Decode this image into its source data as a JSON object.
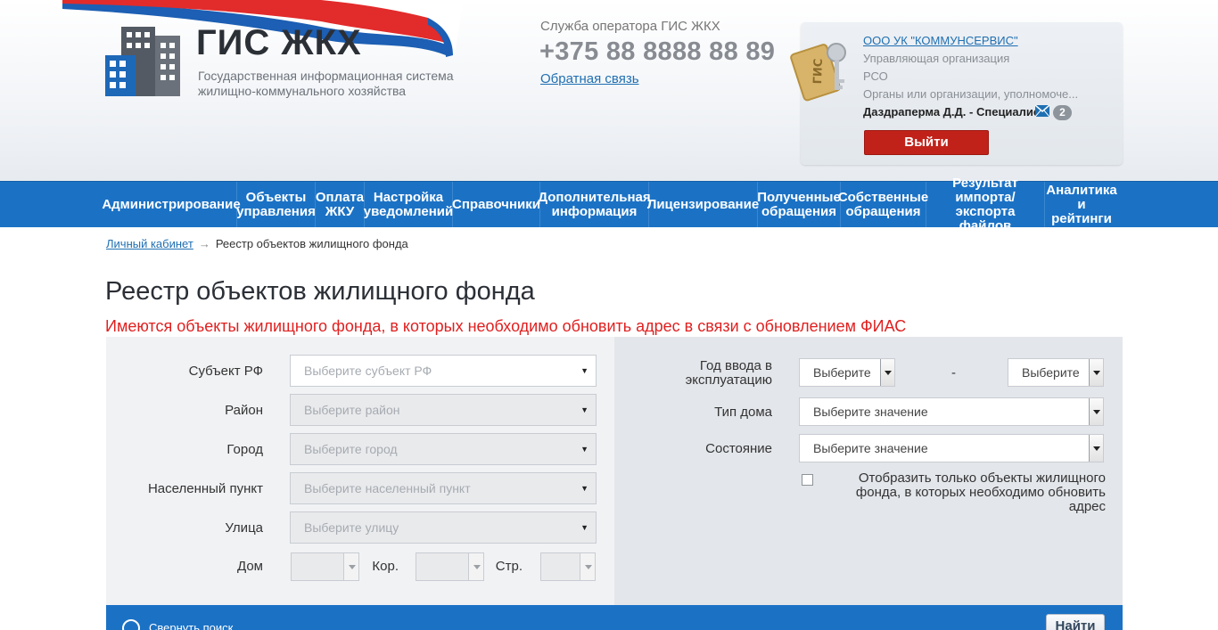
{
  "header": {
    "logo_title": "ГИС ЖКХ",
    "logo_subtitle_1": "Государственная информационная система",
    "logo_subtitle_2": "жилищно-коммунального хозяйства",
    "service_label": "Служба оператора ГИС ЖКХ",
    "service_phone": "+375 88 8888 88 89",
    "feedback_link": "Обратная связь"
  },
  "user_card": {
    "org_name": "ООО УК \"КОММУНСЕРВИС\"",
    "role_1": "Управляющая организация",
    "role_2": "РСО",
    "role_3": "Органы или организации, уполномоче...",
    "user_name": "Даздраперма Д.Д. - Специалист",
    "message_count": "2",
    "logout_label": "Выйти"
  },
  "nav": {
    "items": [
      {
        "label": "Администрирование"
      },
      {
        "label": "Объекты\nуправления"
      },
      {
        "label": "Оплата\nЖКУ"
      },
      {
        "label": "Настройка\nуведомлений"
      },
      {
        "label": "Справочники"
      },
      {
        "label": "Дополнительная\nинформация"
      },
      {
        "label": "Лицензирование"
      },
      {
        "label": "Полученные\nобращения"
      },
      {
        "label": "Собственные\nобращения"
      },
      {
        "label": "Результат\nимпорта/экспорта\nфайлов"
      },
      {
        "label": "Аналитика\nи рейтинги"
      }
    ]
  },
  "breadcrumb": {
    "root": "Личный кабинет",
    "arrow": "→",
    "current": "Реестр объектов жилищного фонда"
  },
  "page": {
    "title": "Реестр объектов жилищного фонда",
    "warning": "Имеются объекты жилищного фонда, в которых необходимо обновить адрес в связи с обновлением ФИАС"
  },
  "filters": {
    "subject_label": "Субъект РФ",
    "subject_placeholder": "Выберите субъект РФ",
    "district_label": "Район",
    "district_placeholder": "Выберите район",
    "city_label": "Город",
    "city_placeholder": "Выберите город",
    "locality_label": "Населенный пункт",
    "locality_placeholder": "Выберите населенный пункт",
    "street_label": "Улица",
    "street_placeholder": "Выберите улицу",
    "house_label": "Дом",
    "korpus_label": "Кор.",
    "building_label": "Стр.",
    "year_label_1": "Год ввода в",
    "year_label_2": "эксплуатацию",
    "year_from": "Выберите",
    "year_dash": "-",
    "year_to": "Выберите",
    "house_type_label": "Тип дома",
    "house_type_value": "Выберите значение",
    "state_label": "Состояние",
    "state_value": "Выберите значение",
    "only_fias_label": "Отобразить только объекты жилищного фонда, в которых необходимо обновить адрес",
    "caret": "▼"
  },
  "bottom": {
    "collapse_label": "Свернуть поиск",
    "find_label": "Найти"
  }
}
